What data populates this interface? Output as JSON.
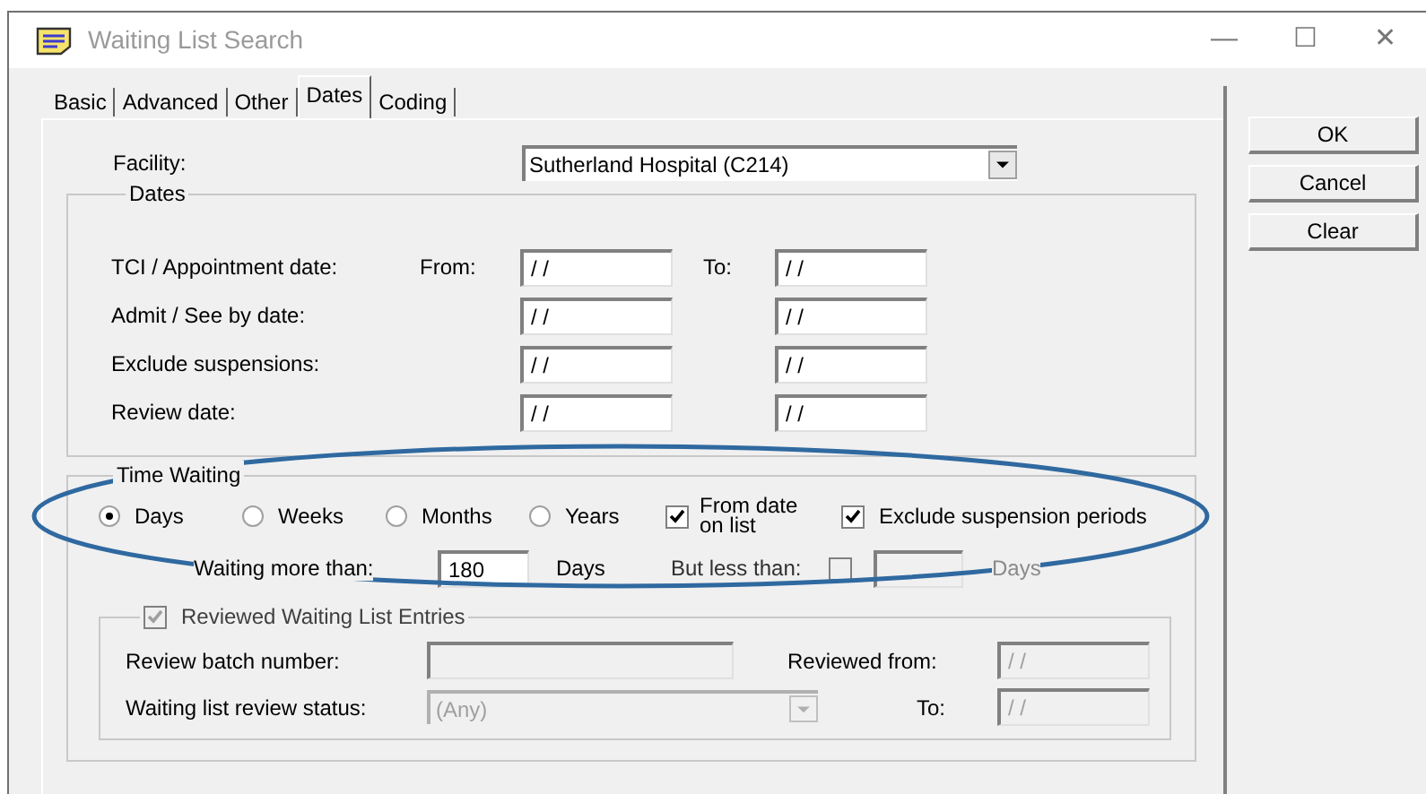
{
  "window": {
    "title": "Waiting List Search",
    "controls": [
      "—",
      "☐",
      "✕"
    ]
  },
  "tabs": [
    {
      "label": "Basic",
      "selected": false
    },
    {
      "label": "Advanced",
      "selected": false
    },
    {
      "label": "Other",
      "selected": false
    },
    {
      "label": "Dates",
      "selected": true
    },
    {
      "label": "Coding",
      "selected": false
    }
  ],
  "facility": {
    "label": "Facility:",
    "value": "Sutherland Hospital (C214)"
  },
  "dates": {
    "title": "Dates",
    "from_label": "From:",
    "to_label": "To:",
    "rows": [
      {
        "label": "TCI / Appointment date:",
        "from": "/ /",
        "to": "/ /"
      },
      {
        "label": "Admit / See by date:",
        "from": "/ /",
        "to": "/ /"
      },
      {
        "label": "Exclude suspensions:",
        "from": "/ /",
        "to": "/ /"
      },
      {
        "label": "Review date:",
        "from": "/ /",
        "to": "/ /"
      }
    ]
  },
  "time_waiting": {
    "title": "Time Waiting",
    "units": [
      {
        "label": "Days",
        "selected": true
      },
      {
        "label": "Weeks",
        "selected": false
      },
      {
        "label": "Months",
        "selected": false
      },
      {
        "label": "Years",
        "selected": false
      }
    ],
    "from_date_on_list": {
      "label": "From date on list",
      "checked": true
    },
    "exclude_suspension_periods": {
      "label": "Exclude suspension periods",
      "checked": true
    },
    "waiting_more_than": {
      "label": "Waiting more than:",
      "value": "180",
      "unit": "Days"
    },
    "but_less_than": {
      "label": "But less than:",
      "checked": false,
      "disabled": true,
      "unit": "Days"
    },
    "reviewed": {
      "label": "Reviewed Waiting List Entries",
      "checked": true,
      "disabled": true,
      "batch_label": "Review batch number:",
      "status_label": "Waiting list review status:",
      "status_value": "(Any)",
      "from_label": "Reviewed from:",
      "from_value": "/ /",
      "to_label": "To:",
      "to_value": "/ /"
    }
  },
  "buttons": [
    "OK",
    "Cancel",
    "Clear"
  ]
}
